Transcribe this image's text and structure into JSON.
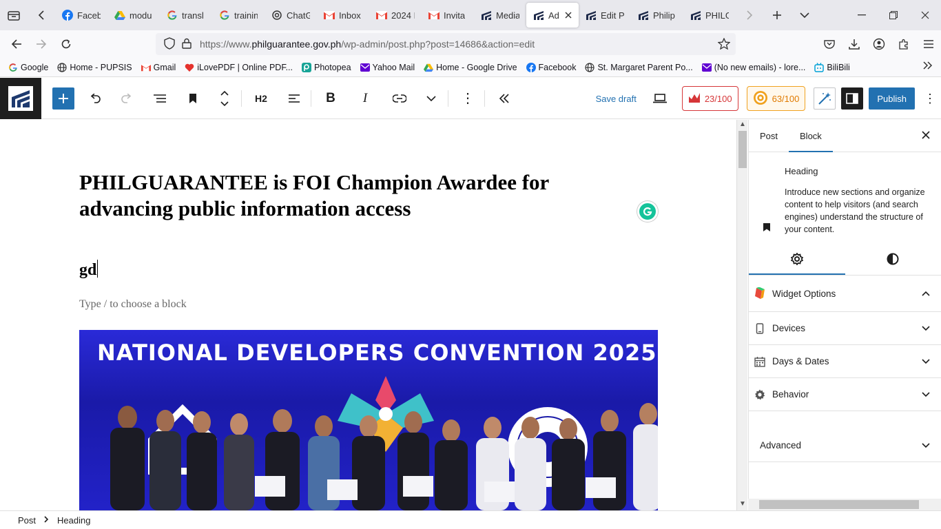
{
  "browser": {
    "tabs": [
      {
        "label": "Faceb",
        "icon": "facebook-icon",
        "color": "#1877f2"
      },
      {
        "label": "modu",
        "icon": "google-drive-icon",
        "color": "#4285f4"
      },
      {
        "label": "transl",
        "icon": "google-icon",
        "color": "#4285f4"
      },
      {
        "label": "trainin",
        "icon": "google-icon",
        "color": "#4285f4"
      },
      {
        "label": "ChatG",
        "icon": "chatgpt-icon",
        "color": "#333333"
      },
      {
        "label": "Inbox",
        "icon": "gmail-icon",
        "color": "#ea4335"
      },
      {
        "label": "2024 I",
        "icon": "gmail-icon",
        "color": "#ea4335"
      },
      {
        "label": "Invita",
        "icon": "gmail-icon",
        "color": "#ea4335"
      },
      {
        "label": "Media",
        "icon": "philguarantee-icon",
        "color": "#1e2a4a"
      },
      {
        "label": "Ad",
        "icon": "philguarantee-icon",
        "color": "#1e2a4a",
        "active": true
      },
      {
        "label": "Edit P",
        "icon": "philguarantee-icon",
        "color": "#1e2a4a"
      },
      {
        "label": "Philip",
        "icon": "philguarantee-icon",
        "color": "#1e2a4a"
      },
      {
        "label": "PHILG",
        "icon": "philguarantee-icon",
        "color": "#1e2a4a"
      }
    ],
    "url_prefix": "https://www.",
    "url_host": "philguarantee.gov.ph",
    "url_path": "/wp-admin/post.php?post=14686&action=edit",
    "bookmarks": [
      {
        "label": "Google",
        "icon": "google-icon",
        "color": "#4285f4"
      },
      {
        "label": "Home - PUPSIS",
        "icon": "globe-icon",
        "color": "#555555"
      },
      {
        "label": "Gmail",
        "icon": "gmail-icon",
        "color": "#ea4335"
      },
      {
        "label": "iLovePDF | Online PDF...",
        "icon": "ilovepdf-icon",
        "color": "#e5322d"
      },
      {
        "label": "Photopea",
        "icon": "photopea-icon",
        "color": "#18a497"
      },
      {
        "label": "Yahoo Mail",
        "icon": "yahoo-icon",
        "color": "#6001d2"
      },
      {
        "label": "Home - Google Drive",
        "icon": "google-drive-icon",
        "color": "#0f9d58"
      },
      {
        "label": "Facebook",
        "icon": "facebook-icon",
        "color": "#1877f2"
      },
      {
        "label": "St. Margaret Parent Po...",
        "icon": "globe-icon",
        "color": "#555555"
      },
      {
        "label": "(No new emails) - lore...",
        "icon": "yahoo-icon",
        "color": "#6001d2"
      },
      {
        "label": "BiliBili",
        "icon": "bilibili-icon",
        "color": "#00a1d6"
      }
    ]
  },
  "editor_header": {
    "heading_level": "H2",
    "save_draft": "Save draft",
    "seo_score": "23/100",
    "readability_score": "63/100",
    "publish": "Publish"
  },
  "content": {
    "title": "PHILGUARANTEE is FOI Champion Awardee for advancing public information access",
    "heading_text": "gd",
    "placeholder": "Type / to choose a block",
    "image_banner": "NATIONAL DEVELOPERS CONVENTION 2025"
  },
  "sidebar": {
    "tab_post": "Post",
    "tab_block": "Block",
    "block_title": "Heading",
    "block_description": "Introduce new sections and organize content to help visitors (and search engines) understand the structure of your content.",
    "panels": [
      {
        "label": "Widget Options",
        "icon": "widget-options-icon",
        "expanded": true
      },
      {
        "label": "Devices",
        "icon": "device-icon"
      },
      {
        "label": "Days & Dates",
        "icon": "calendar-icon"
      },
      {
        "label": "Behavior",
        "icon": "gear-icon"
      }
    ],
    "advanced": "Advanced"
  },
  "footer": {
    "crumbs": [
      "Post",
      "Heading"
    ]
  },
  "colors": {
    "accent": "#2271b1",
    "seo_red": "#d63638",
    "readability_orange": "#e07a00"
  }
}
